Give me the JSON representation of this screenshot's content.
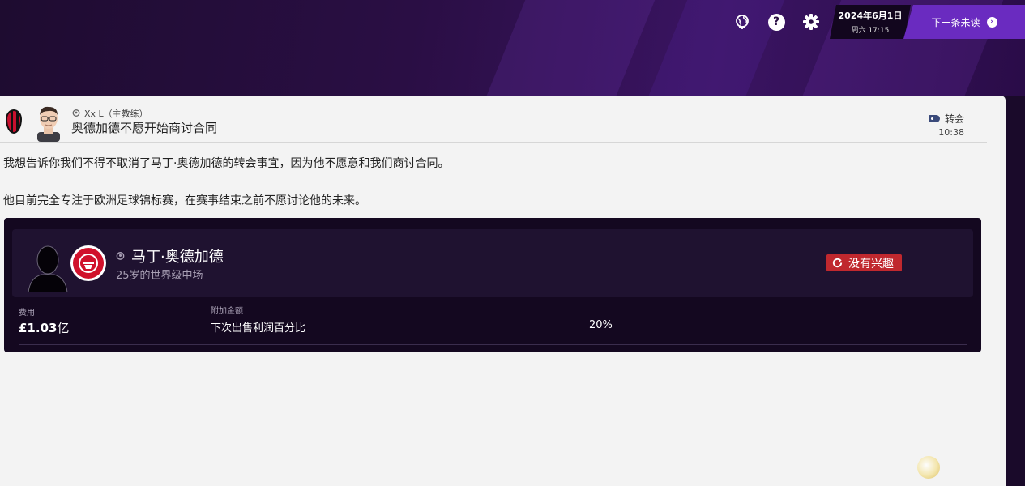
{
  "topbar": {
    "date_line1": "2024年6月1日",
    "date_line2": "周六 17:15",
    "next_unread_label": "下一条未读",
    "icons": [
      "globe-icon",
      "help-icon",
      "settings-icon"
    ],
    "help_glyph": "?"
  },
  "message": {
    "sender": "Xx L（主教练）",
    "subject": "奥德加德不愿开始商讨合同",
    "category": "转会",
    "time": "10:38",
    "paragraphs": [
      "我想告诉你我们不得不取消了马丁·奥德加德的转会事宜，因为他不愿意和我们商讨合同。",
      "他目前完全专注于欧洲足球锦标赛，在赛事结束之前不愿讨论他的未来。"
    ]
  },
  "transfer_card": {
    "player_name": "马丁·奥德加德",
    "player_desc": "25岁的世界级中场",
    "status": "没有兴趣",
    "fee_label": "费用",
    "fee_value": "£1.03",
    "fee_unit": "亿",
    "addon_label": "附加金额",
    "addon_name": "下次出售利润百分比",
    "addon_value": "20%"
  },
  "colors": {
    "accent": "#6a2bc0",
    "status_red": "#c0282e",
    "card_bg": "#140820",
    "panel_bg": "#f3f3f3"
  }
}
